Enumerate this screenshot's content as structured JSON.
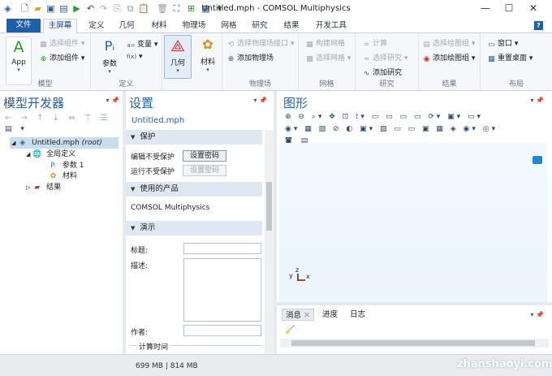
{
  "window": {
    "title": "Untitled.mph - COMSOL Multiphysics",
    "buttons": {
      "minimize": "—",
      "maximize": "☐",
      "close": "✕"
    }
  },
  "menu_tabs": [
    "文件",
    "主屏幕",
    "定义",
    "几何",
    "材料",
    "物理场",
    "网格",
    "研究",
    "结果",
    "开发工具"
  ],
  "help_badge": "?",
  "ribbon": {
    "model": {
      "label": "模型",
      "app": "App",
      "select_component": "选择组件",
      "add_component": "添加组件"
    },
    "definitions": {
      "label": "定义",
      "param": "参数",
      "variable": "变量",
      "fx": "f(x)"
    },
    "geometry": {
      "label": "几何"
    },
    "materials": {
      "label": "材料"
    },
    "physics": {
      "label": "物理场",
      "select_interface": "选择物理场接口",
      "add_physics": "添加物理场"
    },
    "mesh": {
      "label": "网格",
      "build_mesh": "构建网格",
      "select_mesh": "选择网格"
    },
    "study": {
      "label": "研究",
      "compute": "计算",
      "select_study": "选择研究",
      "add_study": "添加研究"
    },
    "results": {
      "label": "结果",
      "select_plot": "选择绘图组",
      "add_plot": "添加绘图组"
    },
    "layout": {
      "label": "布局",
      "window": "窗口",
      "reset_desktop": "重置桌面"
    }
  },
  "model_builder": {
    "title": "模型开发器",
    "tree": {
      "root_name": "Untitled.mph",
      "root_tag": "(root)",
      "global_defs": "全局定义",
      "param1": "参数 1",
      "materials": "材料",
      "results": "结果"
    }
  },
  "settings": {
    "title": "设置",
    "subtitle": "Untitled.mph",
    "protection": {
      "header": "保护",
      "edit_label": "编辑不受保护",
      "edit_button": "设置密码",
      "run_label": "运行不受保护",
      "run_button": "设置密码"
    },
    "products": {
      "header": "使用的产品",
      "value": "COMSOL Multiphysics"
    },
    "presentation": {
      "header": "演示",
      "title_label": "标题:",
      "desc_label": "描述:",
      "author_label": "作者:",
      "compute_time": "计算时间"
    }
  },
  "graphics": {
    "title": "图形",
    "axis": {
      "y": "y",
      "z": "z",
      "x": "x"
    }
  },
  "messages": {
    "tabs": [
      "消息",
      "进度",
      "日志"
    ]
  },
  "status": {
    "memory": "699 MB | 814 MB"
  },
  "watermark": "zhanshaoyi.com"
}
